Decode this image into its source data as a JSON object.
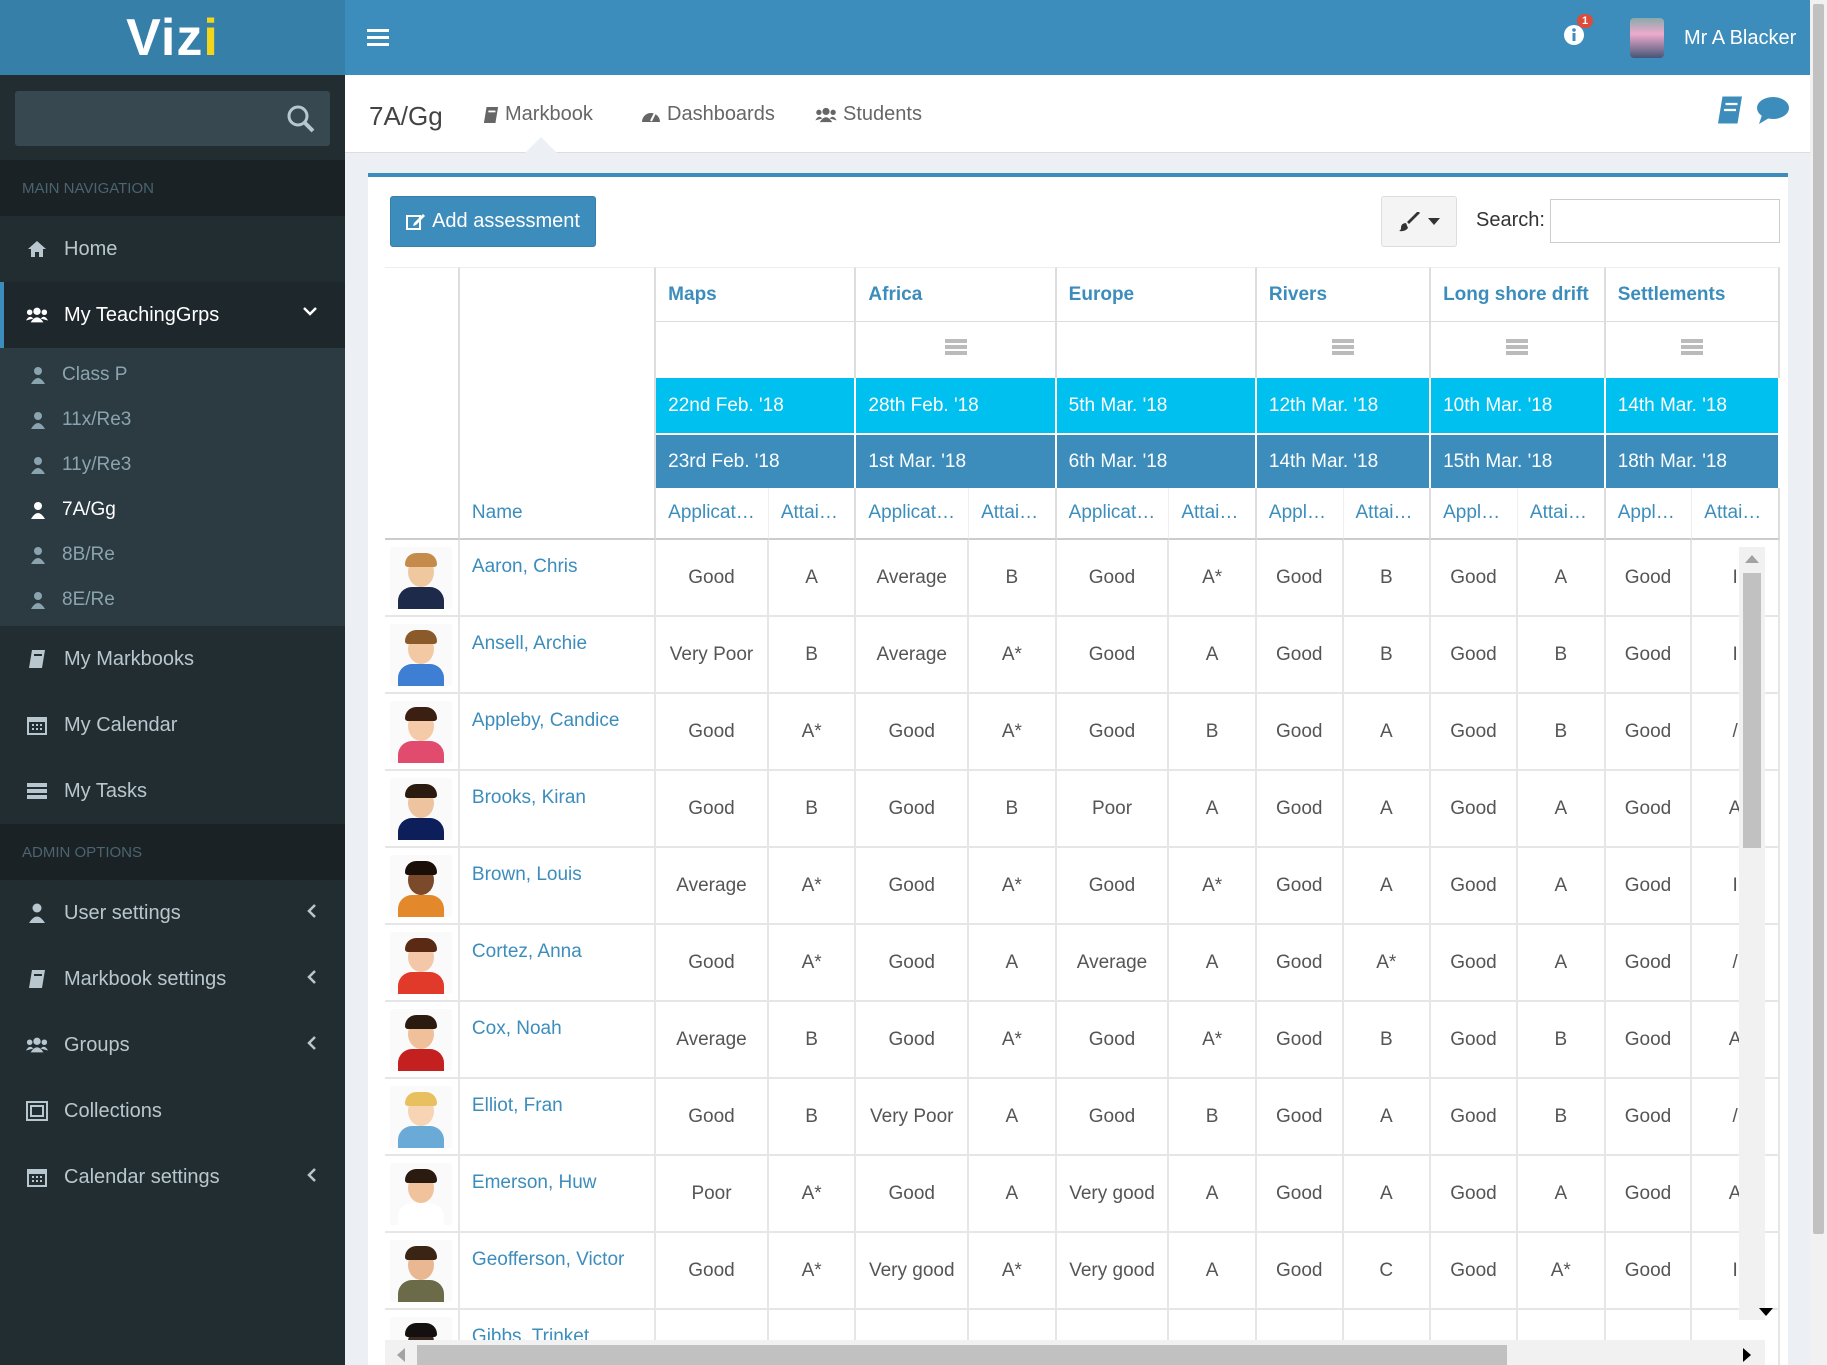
{
  "app": {
    "logo_main": "Viz",
    "logo_i": "i"
  },
  "topbar": {
    "notification_count": "1",
    "user_name": "Mr A Blacker"
  },
  "sidebar": {
    "search_placeholder": "",
    "main_header": "Main Navigation",
    "admin_header": "Admin Options",
    "home": "Home",
    "teaching": "My TeachingGrps",
    "groups": [
      "Class P",
      "11x/Re3",
      "11y/Re3",
      "7A/Gg",
      "8B/Re",
      "8E/Re"
    ],
    "markbooks": "My Markbooks",
    "calendar": "My Calendar",
    "tasks": "My Tasks",
    "user_settings": "User settings",
    "markbook_settings": "Markbook settings",
    "groups_item": "Groups",
    "collections": "Collections",
    "calendar_settings": "Calendar settings"
  },
  "subbar": {
    "group": "7A/Gg",
    "tabs": [
      "Markbook",
      "Dashboards",
      "Students"
    ]
  },
  "toolbar": {
    "add_label": "Add assessment",
    "search_label": "Search:",
    "search_value": ""
  },
  "table": {
    "name_header": "Name",
    "assessments": [
      {
        "title": "Maps",
        "start": "22nd Feb. '18",
        "end": "23rd Feb. '18",
        "has_icon": false,
        "sub": [
          "Applicat…",
          "Attai…"
        ]
      },
      {
        "title": "Africa",
        "start": "28th Feb. '18",
        "end": "1st Mar. '18",
        "has_icon": true,
        "sub": [
          "Applicat…",
          "Attai…"
        ]
      },
      {
        "title": "Europe",
        "start": "5th Mar. '18",
        "end": "6th Mar. '18",
        "has_icon": false,
        "sub": [
          "Applicat…",
          "Attai…"
        ]
      },
      {
        "title": "Rivers",
        "start": "12th Mar. '18",
        "end": "14th Mar. '18",
        "has_icon": true,
        "sub": [
          "Appl…",
          "Attai…"
        ]
      },
      {
        "title": "Long shore drift",
        "start": "10th Mar. '18",
        "end": "15th Mar. '18",
        "has_icon": true,
        "sub": [
          "Appl…",
          "Attai…"
        ]
      },
      {
        "title": "Settlements",
        "start": "14th Mar. '18",
        "end": "18th Mar. '18",
        "has_icon": true,
        "sub": [
          "Appl…",
          "Attai…"
        ]
      }
    ],
    "students": [
      {
        "name": "Aaron, Chris",
        "cells": [
          "Good",
          "A",
          "Average",
          "B",
          "Good",
          "A*",
          "Good",
          "B",
          "Good",
          "A",
          "Good",
          "I"
        ]
      },
      {
        "name": "Ansell, Archie",
        "cells": [
          "Very Poor",
          "B",
          "Average",
          "A*",
          "Good",
          "A",
          "Good",
          "B",
          "Good",
          "B",
          "Good",
          "I"
        ]
      },
      {
        "name": "Appleby, Candice",
        "cells": [
          "Good",
          "A*",
          "Good",
          "A*",
          "Good",
          "B",
          "Good",
          "A",
          "Good",
          "B",
          "Good",
          "/"
        ]
      },
      {
        "name": "Brooks, Kiran",
        "cells": [
          "Good",
          "B",
          "Good",
          "B",
          "Poor",
          "A",
          "Good",
          "A",
          "Good",
          "A",
          "Good",
          "A"
        ]
      },
      {
        "name": "Brown, Louis",
        "cells": [
          "Average",
          "A*",
          "Good",
          "A*",
          "Good",
          "A*",
          "Good",
          "A",
          "Good",
          "A",
          "Good",
          "I"
        ]
      },
      {
        "name": "Cortez, Anna",
        "cells": [
          "Good",
          "A*",
          "Good",
          "A",
          "Average",
          "A",
          "Good",
          "A*",
          "Good",
          "A",
          "Good",
          "/"
        ]
      },
      {
        "name": "Cox, Noah",
        "cells": [
          "Average",
          "B",
          "Good",
          "A*",
          "Good",
          "A*",
          "Good",
          "B",
          "Good",
          "B",
          "Good",
          "A"
        ]
      },
      {
        "name": "Elliot, Fran",
        "cells": [
          "Good",
          "B",
          "Very Poor",
          "A",
          "Good",
          "B",
          "Good",
          "A",
          "Good",
          "B",
          "Good",
          "/"
        ]
      },
      {
        "name": "Emerson, Huw",
        "cells": [
          "Poor",
          "A*",
          "Good",
          "A",
          "Very good",
          "A",
          "Good",
          "A",
          "Good",
          "A",
          "Good",
          "A"
        ]
      },
      {
        "name": "Geofferson, Victor",
        "cells": [
          "Good",
          "A*",
          "Very good",
          "A*",
          "Very good",
          "A",
          "Good",
          "C",
          "Good",
          "A*",
          "Good",
          "I"
        ]
      },
      {
        "name": "Gibbs, Trinket",
        "cells": [
          "",
          "",
          "",
          "",
          "",
          "",
          "",
          "",
          "",
          "",
          "",
          ""
        ]
      }
    ]
  },
  "colors": {
    "brand": "#3c8dbc",
    "accent": "#00c0ef",
    "sidebar": "#222d32"
  }
}
